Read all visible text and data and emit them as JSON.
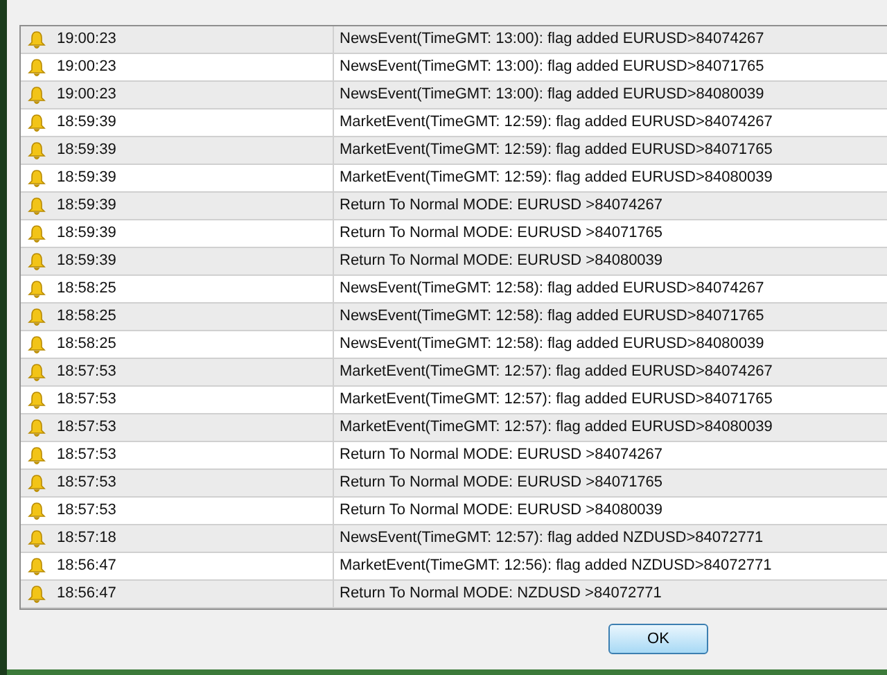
{
  "rows": [
    {
      "time": "19:00:23",
      "message": "NewsEvent(TimeGMT: 13:00): flag added EURUSD>84074267"
    },
    {
      "time": "19:00:23",
      "message": "NewsEvent(TimeGMT: 13:00): flag added EURUSD>84071765"
    },
    {
      "time": "19:00:23",
      "message": "NewsEvent(TimeGMT: 13:00): flag added EURUSD>84080039"
    },
    {
      "time": "18:59:39",
      "message": "MarketEvent(TimeGMT: 12:59): flag added EURUSD>84074267"
    },
    {
      "time": "18:59:39",
      "message": "MarketEvent(TimeGMT: 12:59): flag added EURUSD>84071765"
    },
    {
      "time": "18:59:39",
      "message": "MarketEvent(TimeGMT: 12:59): flag added EURUSD>84080039"
    },
    {
      "time": "18:59:39",
      "message": "Return To Normal MODE: EURUSD >84074267"
    },
    {
      "time": "18:59:39",
      "message": "Return To Normal MODE: EURUSD >84071765"
    },
    {
      "time": "18:59:39",
      "message": "Return To Normal MODE: EURUSD >84080039"
    },
    {
      "time": "18:58:25",
      "message": "NewsEvent(TimeGMT: 12:58): flag added EURUSD>84074267"
    },
    {
      "time": "18:58:25",
      "message": "NewsEvent(TimeGMT: 12:58): flag added EURUSD>84071765"
    },
    {
      "time": "18:58:25",
      "message": "NewsEvent(TimeGMT: 12:58): flag added EURUSD>84080039"
    },
    {
      "time": "18:57:53",
      "message": "MarketEvent(TimeGMT: 12:57): flag added EURUSD>84074267"
    },
    {
      "time": "18:57:53",
      "message": "MarketEvent(TimeGMT: 12:57): flag added EURUSD>84071765"
    },
    {
      "time": "18:57:53",
      "message": "MarketEvent(TimeGMT: 12:57): flag added EURUSD>84080039"
    },
    {
      "time": "18:57:53",
      "message": "Return To Normal MODE: EURUSD >84074267"
    },
    {
      "time": "18:57:53",
      "message": "Return To Normal MODE: EURUSD >84071765"
    },
    {
      "time": "18:57:53",
      "message": "Return To Normal MODE: EURUSD >84080039"
    },
    {
      "time": "18:57:18",
      "message": "NewsEvent(TimeGMT: 12:57): flag added NZDUSD>84072771"
    },
    {
      "time": "18:56:47",
      "message": "MarketEvent(TimeGMT: 12:56): flag added NZDUSD>84072771"
    },
    {
      "time": "18:56:47",
      "message": "Return To Normal MODE: NZDUSD >84072771"
    }
  ],
  "ok_button": "OK"
}
